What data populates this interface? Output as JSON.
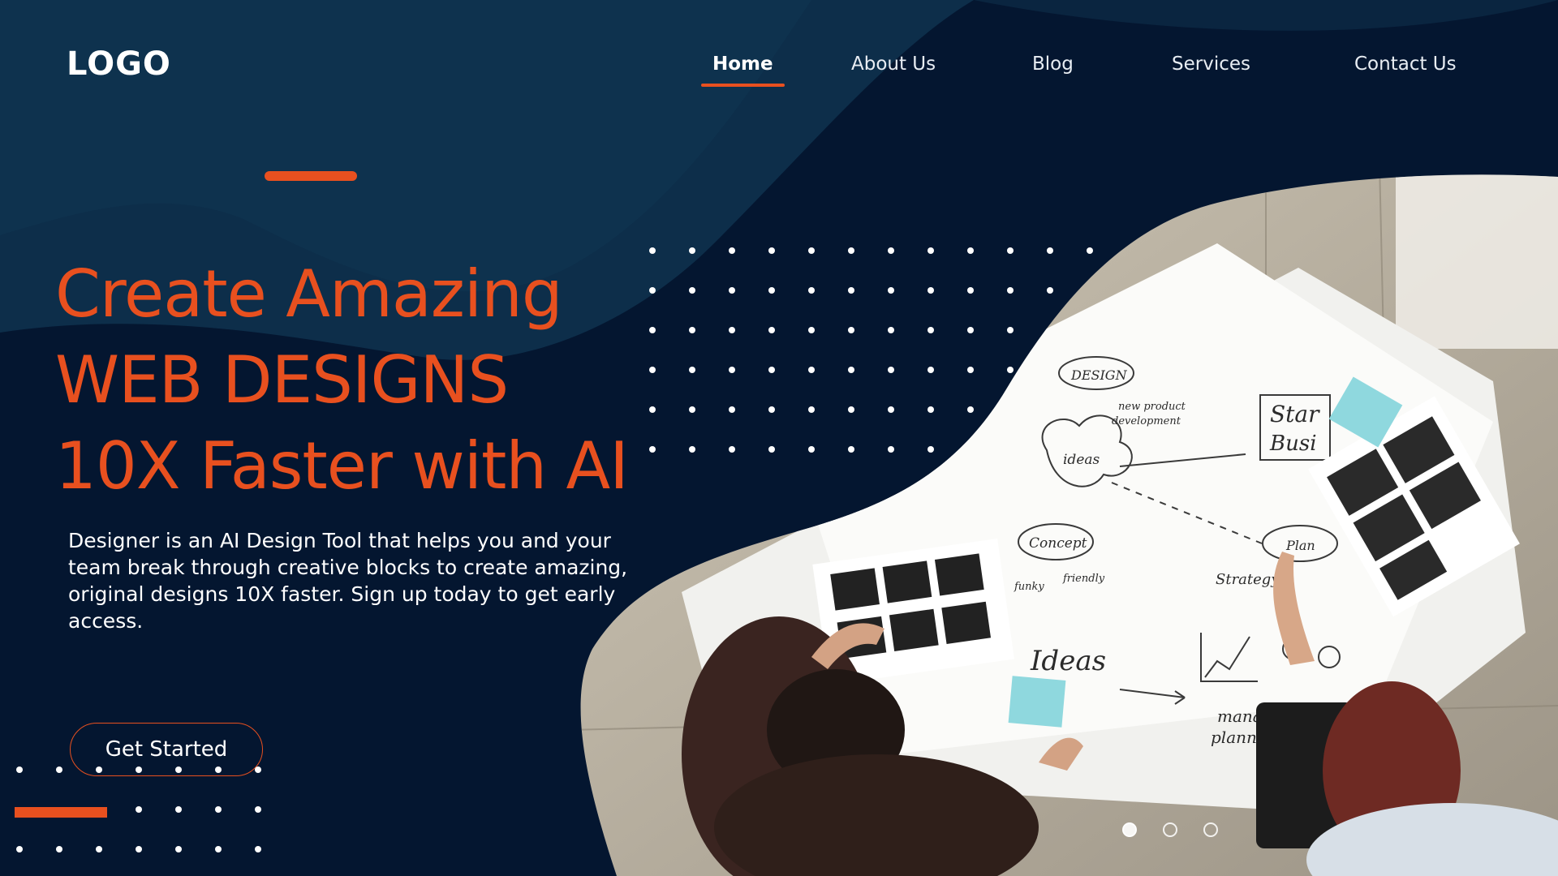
{
  "brand": {
    "logo_text": "LOGO"
  },
  "nav": {
    "items": [
      {
        "label": "Home",
        "active": true
      },
      {
        "label": "About Us",
        "active": false
      },
      {
        "label": "Blog",
        "active": false
      },
      {
        "label": "Services",
        "active": false
      },
      {
        "label": "Contact Us",
        "active": false
      }
    ]
  },
  "hero": {
    "headline_line1": "Create Amazing",
    "headline_line2": "WEB DESIGNS",
    "headline_line3": "10X Faster with AI",
    "description": "Designer is an AI Design Tool that helps you and your team break through creative blocks to create amazing, original designs 10X faster. Sign up today to get early access.",
    "cta_label": "Get Started"
  },
  "photo": {
    "whiteboard_words": [
      "DESIGN",
      "ideas",
      "Concept",
      "Plan",
      "Ideas",
      "Strategy",
      "new product development",
      "friendly",
      "funky",
      "Start Busi",
      "manag planni"
    ]
  },
  "carousel": {
    "slide_count": 3,
    "active_index": 0
  },
  "colors": {
    "background": "#041630",
    "accent": "#e8501f",
    "text": "#ffffff"
  }
}
